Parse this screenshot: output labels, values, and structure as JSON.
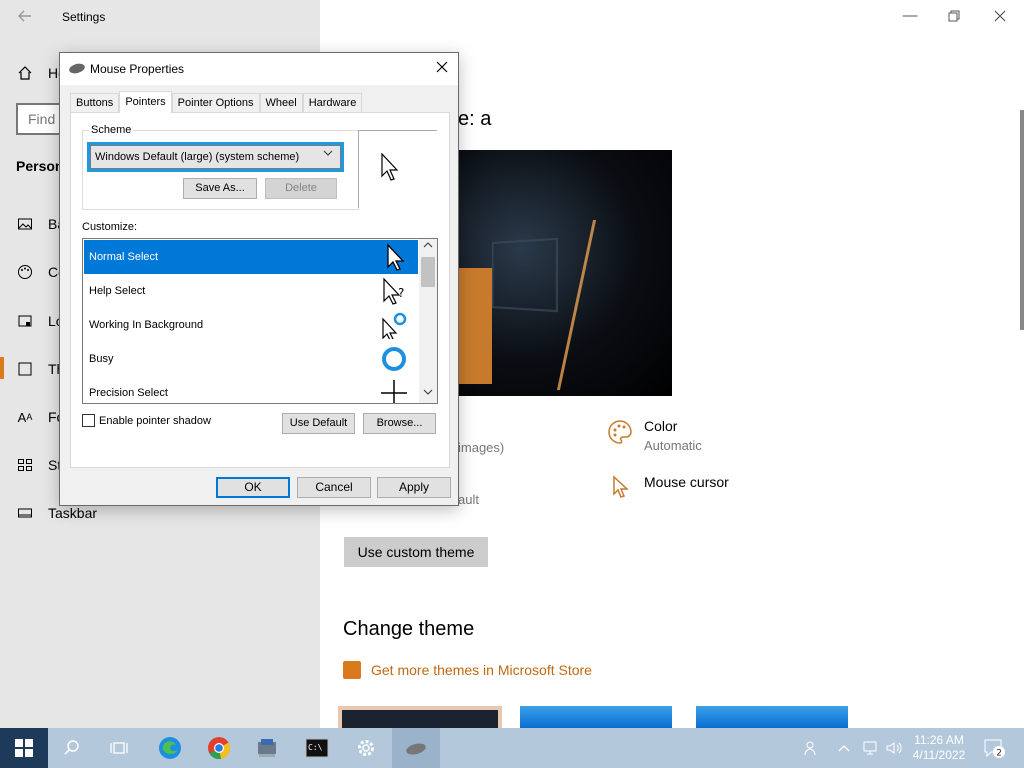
{
  "settings": {
    "title": "Settings",
    "find_placeholder": "Find a",
    "section": "Person",
    "nav": [
      {
        "label": "Ho",
        "icon": "home-icon"
      },
      {
        "label": "Ba",
        "icon": "picture-icon"
      },
      {
        "label": "Co",
        "icon": "palette-icon"
      },
      {
        "label": "Lo",
        "icon": "lock-screen-icon"
      },
      {
        "label": "Th",
        "icon": "themes-icon"
      },
      {
        "label": "Fo",
        "icon": "font-icon"
      },
      {
        "label": "St",
        "icon": "start-icon"
      },
      {
        "label": "Taskbar",
        "icon": "taskbar-icon"
      }
    ],
    "heading": "e: a",
    "partial_images": "images)",
    "partial_ault": "ault",
    "color": {
      "title": "Color",
      "value": "Automatic"
    },
    "mouse_cursor": {
      "title": "Mouse cursor"
    },
    "custom_theme_button": "Use custom theme",
    "change_theme": "Change theme",
    "store_link": "Get more themes in Microsoft Store"
  },
  "dialog": {
    "title": "Mouse Properties",
    "tabs": [
      "Buttons",
      "Pointers",
      "Pointer Options",
      "Wheel",
      "Hardware"
    ],
    "active_tab": "Pointers",
    "scheme_label": "Scheme",
    "scheme_value": "Windows Default (large) (system scheme)",
    "save_as": "Save As...",
    "delete": "Delete",
    "customize_label": "Customize:",
    "cursors": [
      {
        "label": "Normal Select",
        "icon": "arrow-cursor-icon"
      },
      {
        "label": "Help Select",
        "icon": "help-cursor-icon"
      },
      {
        "label": "Working In Background",
        "icon": "working-cursor-icon"
      },
      {
        "label": "Busy",
        "icon": "busy-cursor-icon"
      },
      {
        "label": "Precision Select",
        "icon": "crosshair-cursor-icon"
      }
    ],
    "selected_cursor": "Normal Select",
    "shadow_label": "Enable pointer shadow",
    "shadow_checked": false,
    "use_default": "Use Default",
    "browse": "Browse...",
    "ok": "OK",
    "cancel": "Cancel",
    "apply": "Apply"
  },
  "taskbar": {
    "time": "11:26 AM",
    "date": "4/11/2022",
    "notification_count": "2"
  },
  "colors": {
    "accent_orange": "#c87a2c",
    "selection_blue": "#0078d7",
    "focus_outline": "#1e9ae0",
    "taskbar": "#b4c8dc"
  }
}
